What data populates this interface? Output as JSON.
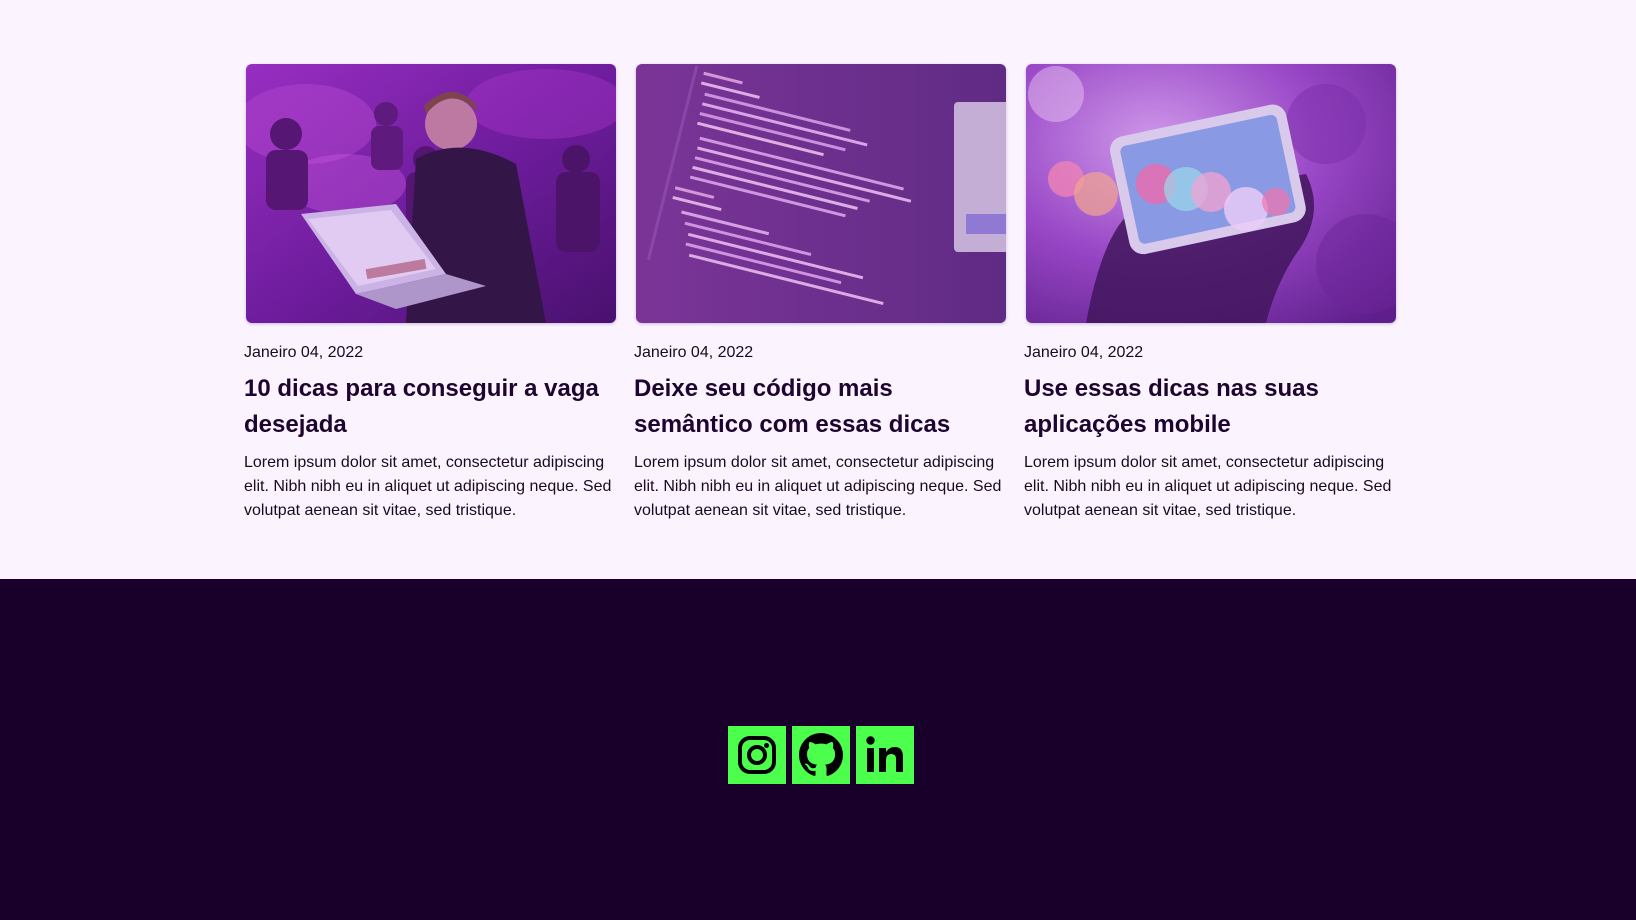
{
  "posts": [
    {
      "image_subject": "person typing on laptop at event",
      "date": "Janeiro 04, 2022",
      "title": "10 dicas para conseguir a vaga desejada",
      "excerpt": "Lorem ipsum dolor sit amet, consectetur adipiscing elit. Nibh nibh eu in aliquet ut adipiscing neque. Sed volutpat aenean sit vitae, sed tristique."
    },
    {
      "image_subject": "HTML source code on screen",
      "date": "Janeiro 04, 2022",
      "title": "Deixe seu código mais semântico com essas dicas",
      "excerpt": "Lorem ipsum dolor sit amet, consectetur adipiscing elit. Nibh nibh eu in aliquet ut adipiscing neque. Sed volutpat aenean sit vitae, sed tristique."
    },
    {
      "image_subject": "hand holding smartphone with bokeh lights",
      "date": "Janeiro 04, 2022",
      "title": "Use essas dicas nas suas aplicações mobile",
      "excerpt": "Lorem ipsum dolor sit amet, consectetur adipiscing elit. Nibh nibh eu in aliquet ut adipiscing neque. Sed volutpat aenean sit vitae, sed tristique."
    }
  ],
  "footer": {
    "social_icons": [
      "instagram-icon",
      "github-icon",
      "linkedin-icon"
    ]
  },
  "colors": {
    "page_background": "#FBF4FF",
    "title": "#1E0530",
    "footer_background": "#18002A",
    "social_accent": "#4CFF4C"
  }
}
